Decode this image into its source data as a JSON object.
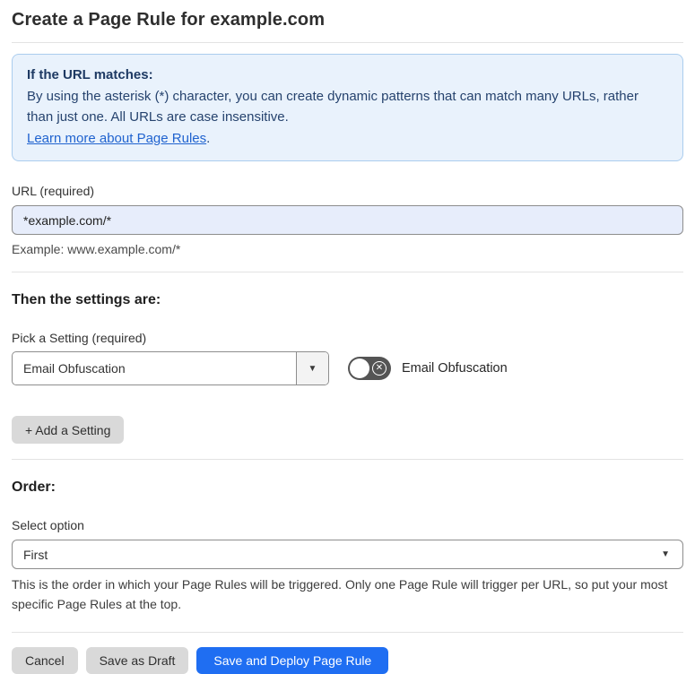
{
  "page": {
    "title": "Create a Page Rule for example.com"
  },
  "info_box": {
    "heading": "If the URL matches:",
    "body": "By using the asterisk (*) character, you can create dynamic patterns that can match many URLs, rather than just one. All URLs are case insensitive.",
    "link_label": "Learn more about Page Rules",
    "link_suffix": "."
  },
  "url_field": {
    "label": "URL (required)",
    "value": "*example.com/*",
    "example": "Example: www.example.com/*"
  },
  "settings_section": {
    "heading": "Then the settings are:",
    "setting_label": "Pick a Setting (required)",
    "setting_selected": "Email Obfuscation",
    "toggle_label": "Email Obfuscation",
    "toggle_state": "off",
    "add_button_label": "+ Add a Setting"
  },
  "order_section": {
    "heading": "Order:",
    "select_label": "Select option",
    "select_selected": "First",
    "help_text": "This is the order in which your Page Rules will be triggered. Only one Page Rule will trigger per URL, so put your most specific Page Rules at the top."
  },
  "footer": {
    "cancel_label": "Cancel",
    "save_draft_label": "Save as Draft",
    "save_deploy_label": "Save and Deploy Page Rule"
  },
  "icons": {
    "caret_down": "▼",
    "toggle_off_x": "✕"
  },
  "colors": {
    "primary_blue": "#1f6ef2",
    "info_background": "#e9f2fc",
    "info_border": "#abcdee",
    "info_text": "#1e3a63",
    "link_blue": "#2063cf",
    "input_fill": "#e7edfb",
    "toggle_off": "#545454",
    "button_gray": "#d9d9d9"
  }
}
